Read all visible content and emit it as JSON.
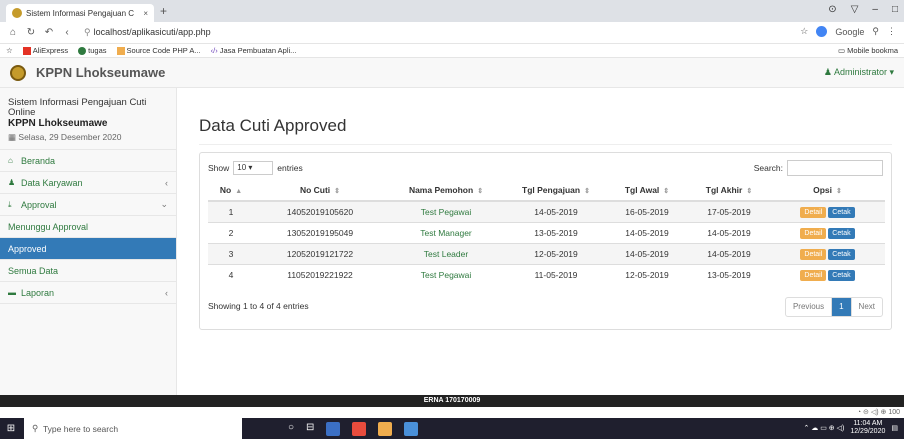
{
  "browser": {
    "tab_title": "Sistem Informasi Pengajuan C",
    "tab_close": "×",
    "new_tab": "+",
    "url": "localhost/aplikasicuti/app.php",
    "search_engine": "Google",
    "bookmarks": [
      "AliExpress",
      "tugas",
      "Source Code PHP A...",
      "Jasa Pembuatan Apli..."
    ],
    "mobile_bookmarks": "Mobile bookma"
  },
  "navbar": {
    "brand": "KPPN Lhokseumawe",
    "user": "Administrator"
  },
  "sidebar": {
    "app_name": "Sistem Informasi Pengajuan Cuti Online",
    "office": "KPPN Lhokseumawe",
    "date": "Selasa, 29 Desember 2020",
    "items": [
      {
        "label": "Beranda"
      },
      {
        "label": "Data Karyawan"
      },
      {
        "label": "Approval"
      },
      {
        "label": "Laporan"
      }
    ],
    "approval_sub": [
      {
        "label": "Menunggu Approval"
      },
      {
        "label": "Approved"
      },
      {
        "label": "Semua Data"
      }
    ]
  },
  "main": {
    "title": "Data Cuti Approved",
    "show_label": "Show",
    "entries_count": "10",
    "entries_label": "entries",
    "search_label": "Search:",
    "columns": [
      "No",
      "No Cuti",
      "Nama Pemohon",
      "Tgl Pengajuan",
      "Tgl Awal",
      "Tgl Akhir",
      "Opsi"
    ],
    "rows": [
      {
        "no": "1",
        "no_cuti": "14052019105620",
        "nama": "Test Pegawai",
        "tgl_pengajuan": "14-05-2019",
        "tgl_awal": "16-05-2019",
        "tgl_akhir": "17-05-2019"
      },
      {
        "no": "2",
        "no_cuti": "13052019195049",
        "nama": "Test Manager",
        "tgl_pengajuan": "13-05-2019",
        "tgl_awal": "14-05-2019",
        "tgl_akhir": "14-05-2019"
      },
      {
        "no": "3",
        "no_cuti": "12052019121722",
        "nama": "Test Leader",
        "tgl_pengajuan": "12-05-2019",
        "tgl_awal": "14-05-2019",
        "tgl_akhir": "14-05-2019"
      },
      {
        "no": "4",
        "no_cuti": "11052019221922",
        "nama": "Test Pegawai",
        "tgl_pengajuan": "11-05-2019",
        "tgl_awal": "12-05-2019",
        "tgl_akhir": "13-05-2019"
      }
    ],
    "detail_label": "Detail",
    "cetak_label": "Cetak",
    "info": "Showing 1 to 4 of 4 entries",
    "pager": {
      "previous": "Previous",
      "current": "1",
      "next": "Next"
    }
  },
  "footer": {
    "text": "ERNA 170170009"
  },
  "status": {
    "zoom": "100"
  },
  "taskbar": {
    "search_placeholder": "Type here to search",
    "time": "11:04 AM",
    "date": "12/29/2020"
  },
  "colors": {
    "accent": "#337ab7",
    "link_green": "#2f7a3f",
    "warning": "#f0ad4e"
  }
}
